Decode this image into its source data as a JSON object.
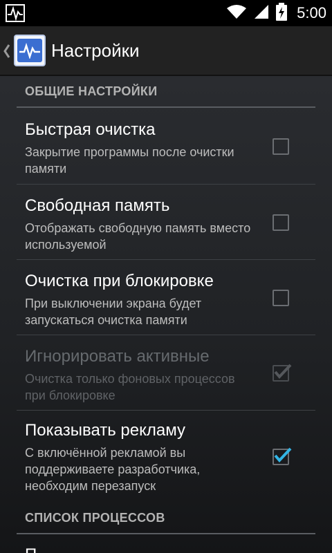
{
  "status_bar": {
    "time": "5:00",
    "icons": [
      "activity-icon",
      "wifi-icon",
      "signal-icon",
      "battery-charging-icon"
    ]
  },
  "action_bar": {
    "title": "Настройки",
    "icons": [
      "up-caret-icon",
      "app-logo-icon"
    ]
  },
  "sections": [
    {
      "header": "ОБЩИЕ НАСТРОЙКИ",
      "items": [
        {
          "title": "Быстрая очистка",
          "summary": "Закрытие программы после очистки памяти",
          "checked": false,
          "enabled": true
        },
        {
          "title": "Свободная память",
          "summary": "Отображать свободную память вместо используемой",
          "checked": false,
          "enabled": true
        },
        {
          "title": "Очистка при блокировке",
          "summary": "При выключении экрана будет запускаться очистка памяти",
          "checked": false,
          "enabled": true
        },
        {
          "title": "Игнорировать активные",
          "summary": "Очистка только фоновых процессов при блокировке",
          "checked": true,
          "enabled": false
        },
        {
          "title": "Показывать рекламу",
          "summary": "С включённой рекламой вы поддерживаете разработчика, необходим перезапуск",
          "checked": true,
          "enabled": true
        }
      ]
    },
    {
      "header": "СПИСОК ПРОЦЕССОВ",
      "items": [
        {
          "title": "П",
          "summary": "",
          "checked": false,
          "enabled": true
        }
      ]
    }
  ],
  "colors": {
    "accent_check": "#33b5e5",
    "action_bar": "#222222",
    "status_bar": "#000000"
  }
}
